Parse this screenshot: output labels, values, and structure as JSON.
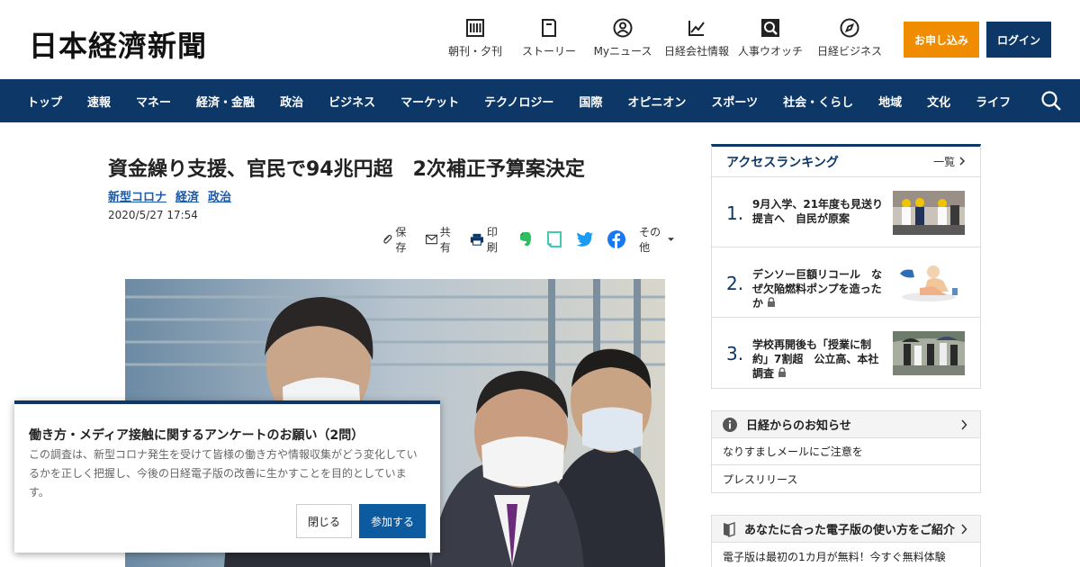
{
  "header": {
    "logo": "日本経濟新聞",
    "icons": [
      {
        "icon": "newspaper-icon",
        "label": "朝刊・夕刊"
      },
      {
        "icon": "book-icon",
        "label": "ストーリー"
      },
      {
        "icon": "user-icon",
        "label": "Myニュース"
      },
      {
        "icon": "chart-icon",
        "label": "日経会社情報"
      },
      {
        "icon": "search-person-icon",
        "label": "人事ウオッチ"
      },
      {
        "icon": "compass-icon",
        "label": "日経ビジネス"
      }
    ],
    "apply_label": "お申し込み",
    "login_label": "ログイン"
  },
  "nav": {
    "items": [
      "トップ",
      "速報",
      "マネー",
      "経済・金融",
      "政治",
      "ビジネス",
      "マーケット",
      "テクノロジー",
      "国際",
      "オピニオン",
      "スポーツ",
      "社会・くらし",
      "地域",
      "文化",
      "ライフ"
    ]
  },
  "article": {
    "title": "資金繰り支援、官民で94兆円超　2次補正予算案決定",
    "tags": [
      "新型コロナ",
      "経済",
      "政治"
    ],
    "date": "2020/5/27 17:54",
    "share": {
      "save": "保存",
      "share": "共有",
      "print": "印刷",
      "other": "その他"
    }
  },
  "ranking": {
    "title": "アクセスランキング",
    "more": "一覧",
    "items": [
      {
        "num": "1.",
        "text": "9月入学、21年度も見送り提言へ　自民が原案"
      },
      {
        "num": "2.",
        "text": "デンソー巨額リコール　なぜ欠陥燃料ポンプを造ったか"
      },
      {
        "num": "3.",
        "text": "学校再開後も「授業に制約」7割超　公立高、本社調査"
      }
    ]
  },
  "notice": {
    "title": "日経からのお知らせ",
    "rows": [
      "なりすましメールにご注意を",
      "プレスリリース"
    ]
  },
  "guide": {
    "title": "あなたに合った電子版の使い方をご紹介",
    "row": "電子版は最初の1カ月が無料！今すぐ無料体験"
  },
  "survey": {
    "title": "働き方・メディア接触に関するアンケートのお願い（2問）",
    "body": "この調査は、新型コロナ発生を受けて皆様の働き方や情報収集がどう変化しているかを正しく把握し、今後の日経電子版の改善に生かすことを目的としています。",
    "close_label": "閉じる",
    "join_label": "参加する"
  },
  "colors": {
    "brand_navy": "#0c3766",
    "apply_orange": "#f08c00",
    "link_blue": "#1a5aa6"
  }
}
